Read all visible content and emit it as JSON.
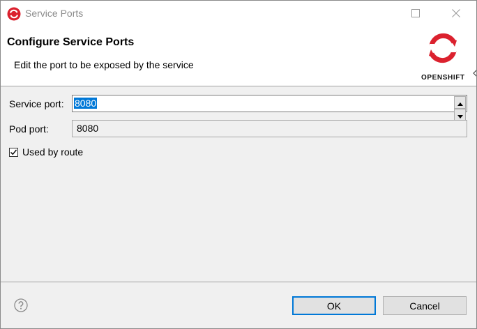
{
  "window": {
    "title": "Service Ports"
  },
  "banner": {
    "title": "Configure Service Ports",
    "description": "Edit the port to be exposed by the service",
    "logo_text": "OPENSHIFT"
  },
  "form": {
    "service_port_label": "Service port:",
    "service_port_value": "8080",
    "pod_port_label": "Pod port:",
    "pod_port_value": "8080",
    "used_by_route_label": "Used by route",
    "used_by_route_checked": true
  },
  "buttons": {
    "ok_label": "OK",
    "cancel_label": "Cancel"
  },
  "icons": {
    "app": "openshift-app-icon",
    "maximize": "maximize-icon",
    "close": "close-icon",
    "help": "help-icon",
    "logo": "openshift-logo-icon"
  },
  "colors": {
    "brand_red": "#db212e",
    "selection_blue": "#0078d7",
    "dialog_bg": "#f0f0f0"
  }
}
